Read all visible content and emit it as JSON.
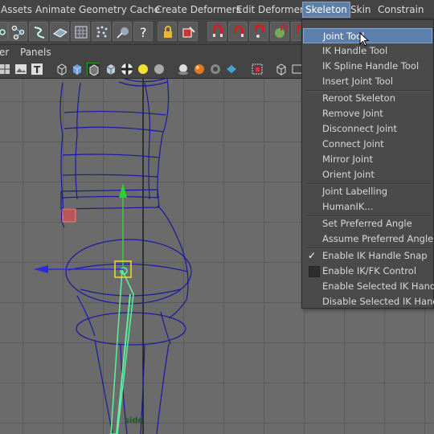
{
  "menubar": {
    "items": [
      "Assets",
      "Animate",
      "Geometry Cache",
      "Create Deformers",
      "Edit Deformers",
      "Skeleton",
      "Skin",
      "Constrain"
    ],
    "active": "Skeleton"
  },
  "panelbar": {
    "items": [
      "er",
      "Panels"
    ]
  },
  "viewport": {
    "camera_label": "side"
  },
  "dropdown": {
    "groups": [
      [
        "Joint Tool",
        "IK Handle Tool",
        "IK Spline Handle Tool",
        "Insert Joint Tool"
      ],
      [
        "Reroot Skeleton",
        "Remove Joint",
        "Disconnect Joint",
        "Connect Joint",
        "Mirror Joint",
        "Orient Joint"
      ],
      [
        "Joint Labelling",
        "HumanIK..."
      ],
      [
        "Set Preferred Angle",
        "Assume Preferred Angle"
      ],
      [
        "Enable IK Handle Snap",
        "Enable IK/FK Control",
        "Enable Selected IK Handles",
        "Disable Selected IK Handles"
      ]
    ],
    "highlighted": "Joint Tool",
    "checked": [
      "Enable IK Handle Snap"
    ],
    "unchecked_boxes": [
      "Enable IK/FK Control"
    ]
  },
  "colors": {
    "menu_highlight": "#5d7fae",
    "wireframe": "#1a1aa0",
    "joint_green": "#5cf0a0",
    "axis_y": "#2fd02f",
    "axis_z": "#2a2ae0",
    "manip_yellow": "#f0e020"
  },
  "icons": {
    "shelf": [
      "joint-tool-icon",
      "ik-handle-icon",
      "ik-spline-icon",
      "plane-icon",
      "lattice-icon",
      "cluster-icon",
      "wire-icon",
      "help-icon",
      "lock-icon",
      "paint-icon",
      "magnet-icon",
      "magnet-icon",
      "magnet-icon",
      "sphere-magnet-icon",
      "magnet-icon"
    ]
  }
}
